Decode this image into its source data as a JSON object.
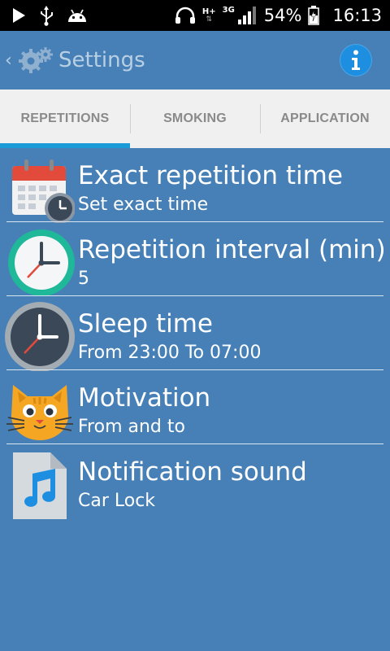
{
  "status_bar": {
    "network_top": "H+",
    "network_3g": "3G",
    "battery": "54%",
    "time": "16:13"
  },
  "action_bar": {
    "back_icon": "chevron-left-icon",
    "logo_icon": "gears-icon",
    "title": "Settings",
    "info_icon": "info-icon"
  },
  "tabs": [
    {
      "label": "REPETITIONS",
      "active": true
    },
    {
      "label": "SMOKING",
      "active": false
    },
    {
      "label": "APPLICATION",
      "active": false
    }
  ],
  "settings": [
    {
      "icon": "calendar-clock-icon",
      "title": "Exact repetition time",
      "subtitle": "Set exact time"
    },
    {
      "icon": "clock-icon",
      "title": "Repetition interval (min)",
      "subtitle": "5"
    },
    {
      "icon": "dark-clock-icon",
      "title": "Sleep time",
      "subtitle": "From 23:00 To 07:00"
    },
    {
      "icon": "cat-icon",
      "title": "Motivation",
      "subtitle": "From and to"
    },
    {
      "icon": "music-file-icon",
      "title": "Notification sound",
      "subtitle": "Car Lock"
    }
  ],
  "colors": {
    "background": "#4780B7",
    "tab_bar": "#F0F0F0",
    "tab_indicator": "#1A9AD6",
    "info_button": "#1E8FE0"
  }
}
